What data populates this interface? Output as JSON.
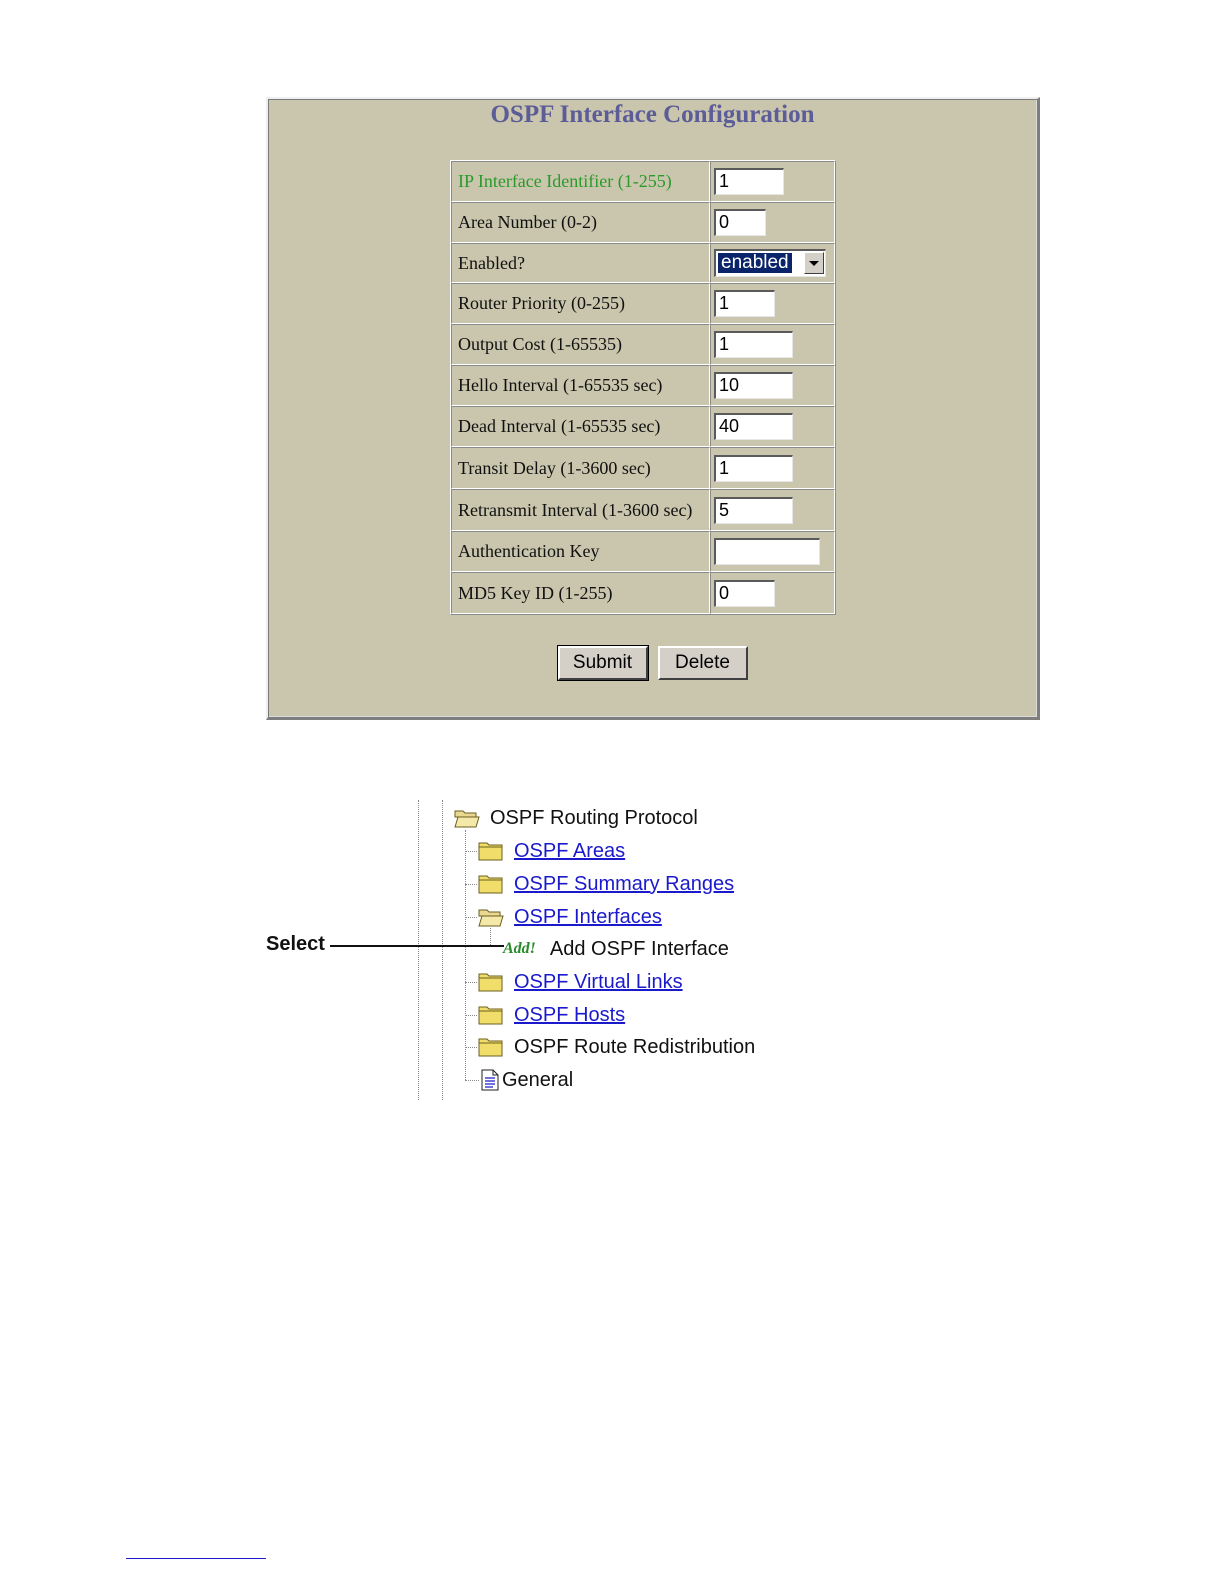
{
  "form": {
    "title": "OSPF Interface Configuration",
    "fields": [
      {
        "label": "IP Interface Identifier  (1-255)",
        "value": "1"
      },
      {
        "label": "Area Number  (0-2)",
        "value": "0"
      },
      {
        "label": "Enabled?",
        "value": "enabled"
      },
      {
        "label": "Router Priority (0-255)",
        "value": "1"
      },
      {
        "label": "Output Cost (1-65535)",
        "value": "1"
      },
      {
        "label": "Hello Interval (1-65535 sec)",
        "value": "10"
      },
      {
        "label": "Dead Interval (1-65535 sec)",
        "value": "40"
      },
      {
        "label": "Transit Delay (1-3600 sec)",
        "value": "1"
      },
      {
        "label": "Retransmit Interval (1-3600 sec)",
        "value": "5"
      },
      {
        "label": "Authentication Key",
        "value": ""
      },
      {
        "label": "MD5 Key ID (1-255)",
        "value": "0"
      }
    ],
    "submit_label": "Submit",
    "delete_label": "Delete"
  },
  "tree": {
    "root": "OSPF Routing Protocol",
    "items": [
      {
        "label": "OSPF Areas",
        "icon": "folder-icon"
      },
      {
        "label": "OSPF Summary Ranges",
        "icon": "folder-icon"
      },
      {
        "label": "OSPF Interfaces",
        "icon": "open-folder-icon"
      },
      {
        "badge": "Add!",
        "label": "Add OSPF Interface"
      },
      {
        "label": "OSPF Virtual Links",
        "icon": "folder-icon"
      },
      {
        "label": "OSPF Hosts",
        "icon": "folder-icon"
      },
      {
        "label": "OSPF Route Redistribution",
        "icon": "folder-icon"
      },
      {
        "label": "General",
        "icon": "document-icon"
      }
    ]
  },
  "callout": {
    "label": "Select"
  },
  "colors": {
    "panel_bg": "#c9c6ad",
    "title": "#5c5c98",
    "link": "#1a1acc",
    "green_label": "#2a9a2a"
  }
}
